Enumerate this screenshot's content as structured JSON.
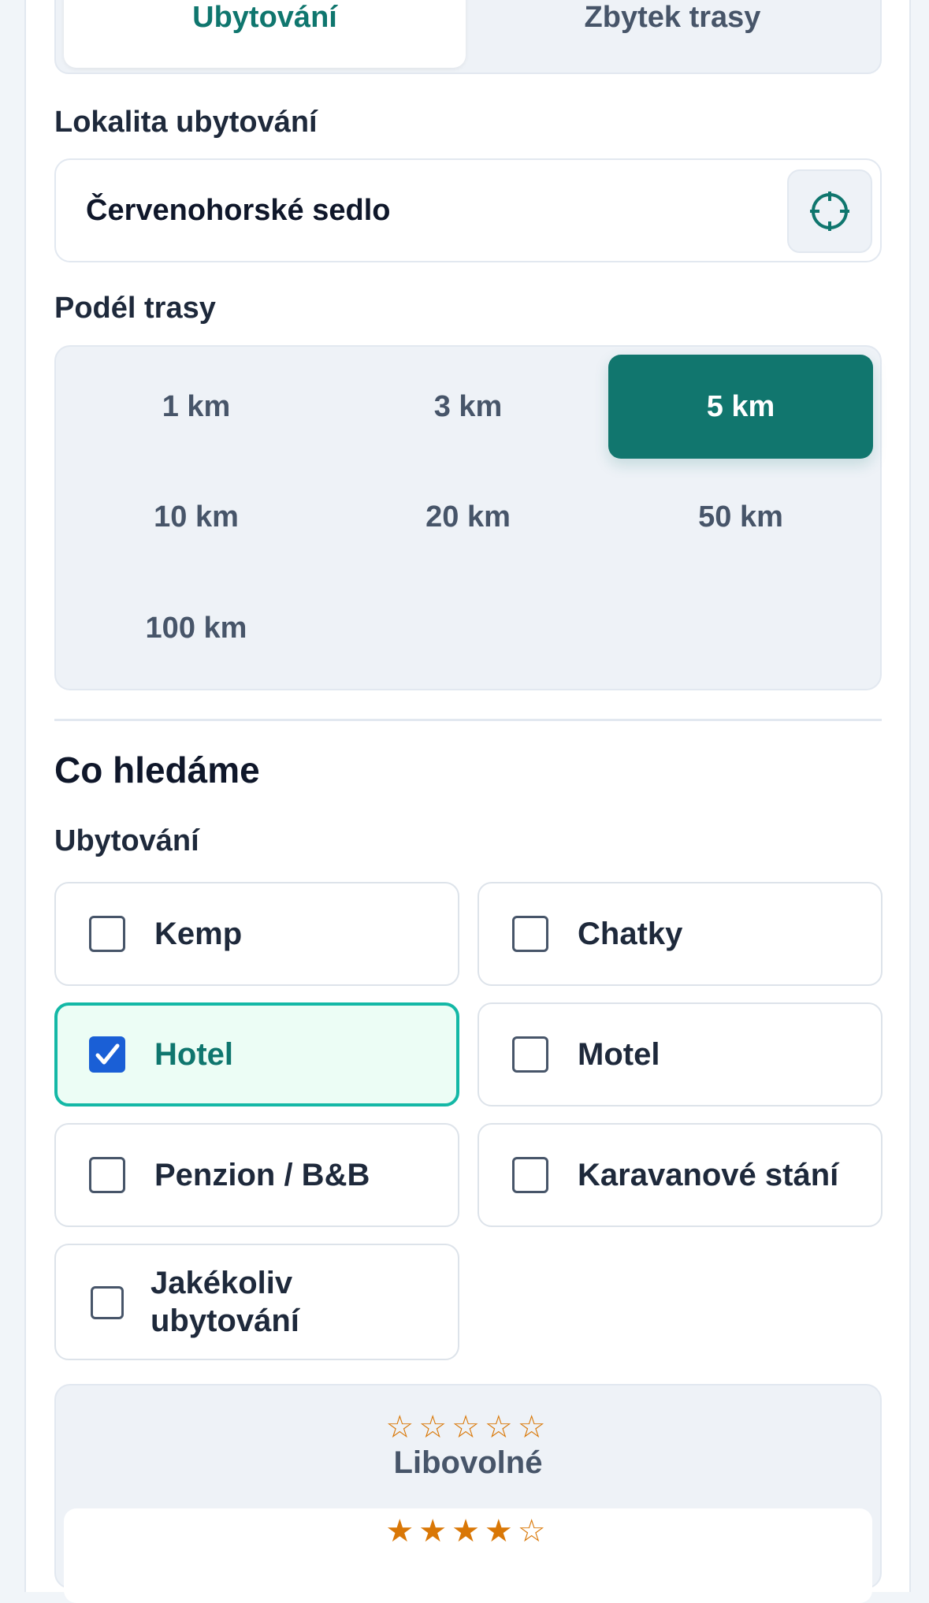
{
  "tabs": {
    "accommodation": "Ubytování",
    "rest_of_route": "Zbytek trasy"
  },
  "location": {
    "label": "Lokalita ubytování",
    "value": "Červenohorské sedlo",
    "locate_icon": "crosshair-icon"
  },
  "distance": {
    "label": "Podél trasy",
    "options": [
      "1 km",
      "3 km",
      "5 km",
      "10 km",
      "20 km",
      "50 km",
      "100 km"
    ],
    "selected": "5 km"
  },
  "search": {
    "title": "Co hledáme",
    "accommodation_label": "Ubytování",
    "options": [
      {
        "label": "Kemp",
        "checked": false
      },
      {
        "label": "Chatky",
        "checked": false
      },
      {
        "label": "Hotel",
        "checked": true
      },
      {
        "label": "Motel",
        "checked": false
      },
      {
        "label": "Penzion / B&B",
        "checked": false
      },
      {
        "label": "Karavanové stání",
        "checked": false
      },
      {
        "label": "Jakékoliv\nubytování",
        "checked": false
      }
    ]
  },
  "rating": {
    "options": [
      {
        "stars": "☆☆☆☆☆",
        "label": "Libovolné",
        "filled": 0
      },
      {
        "stars": "★★★★☆",
        "filled": 4
      }
    ]
  },
  "colors": {
    "accent": "#11766e",
    "checked_border": "#14b8a6",
    "star": "#d97706",
    "checkbox": "#1a5fd6"
  }
}
